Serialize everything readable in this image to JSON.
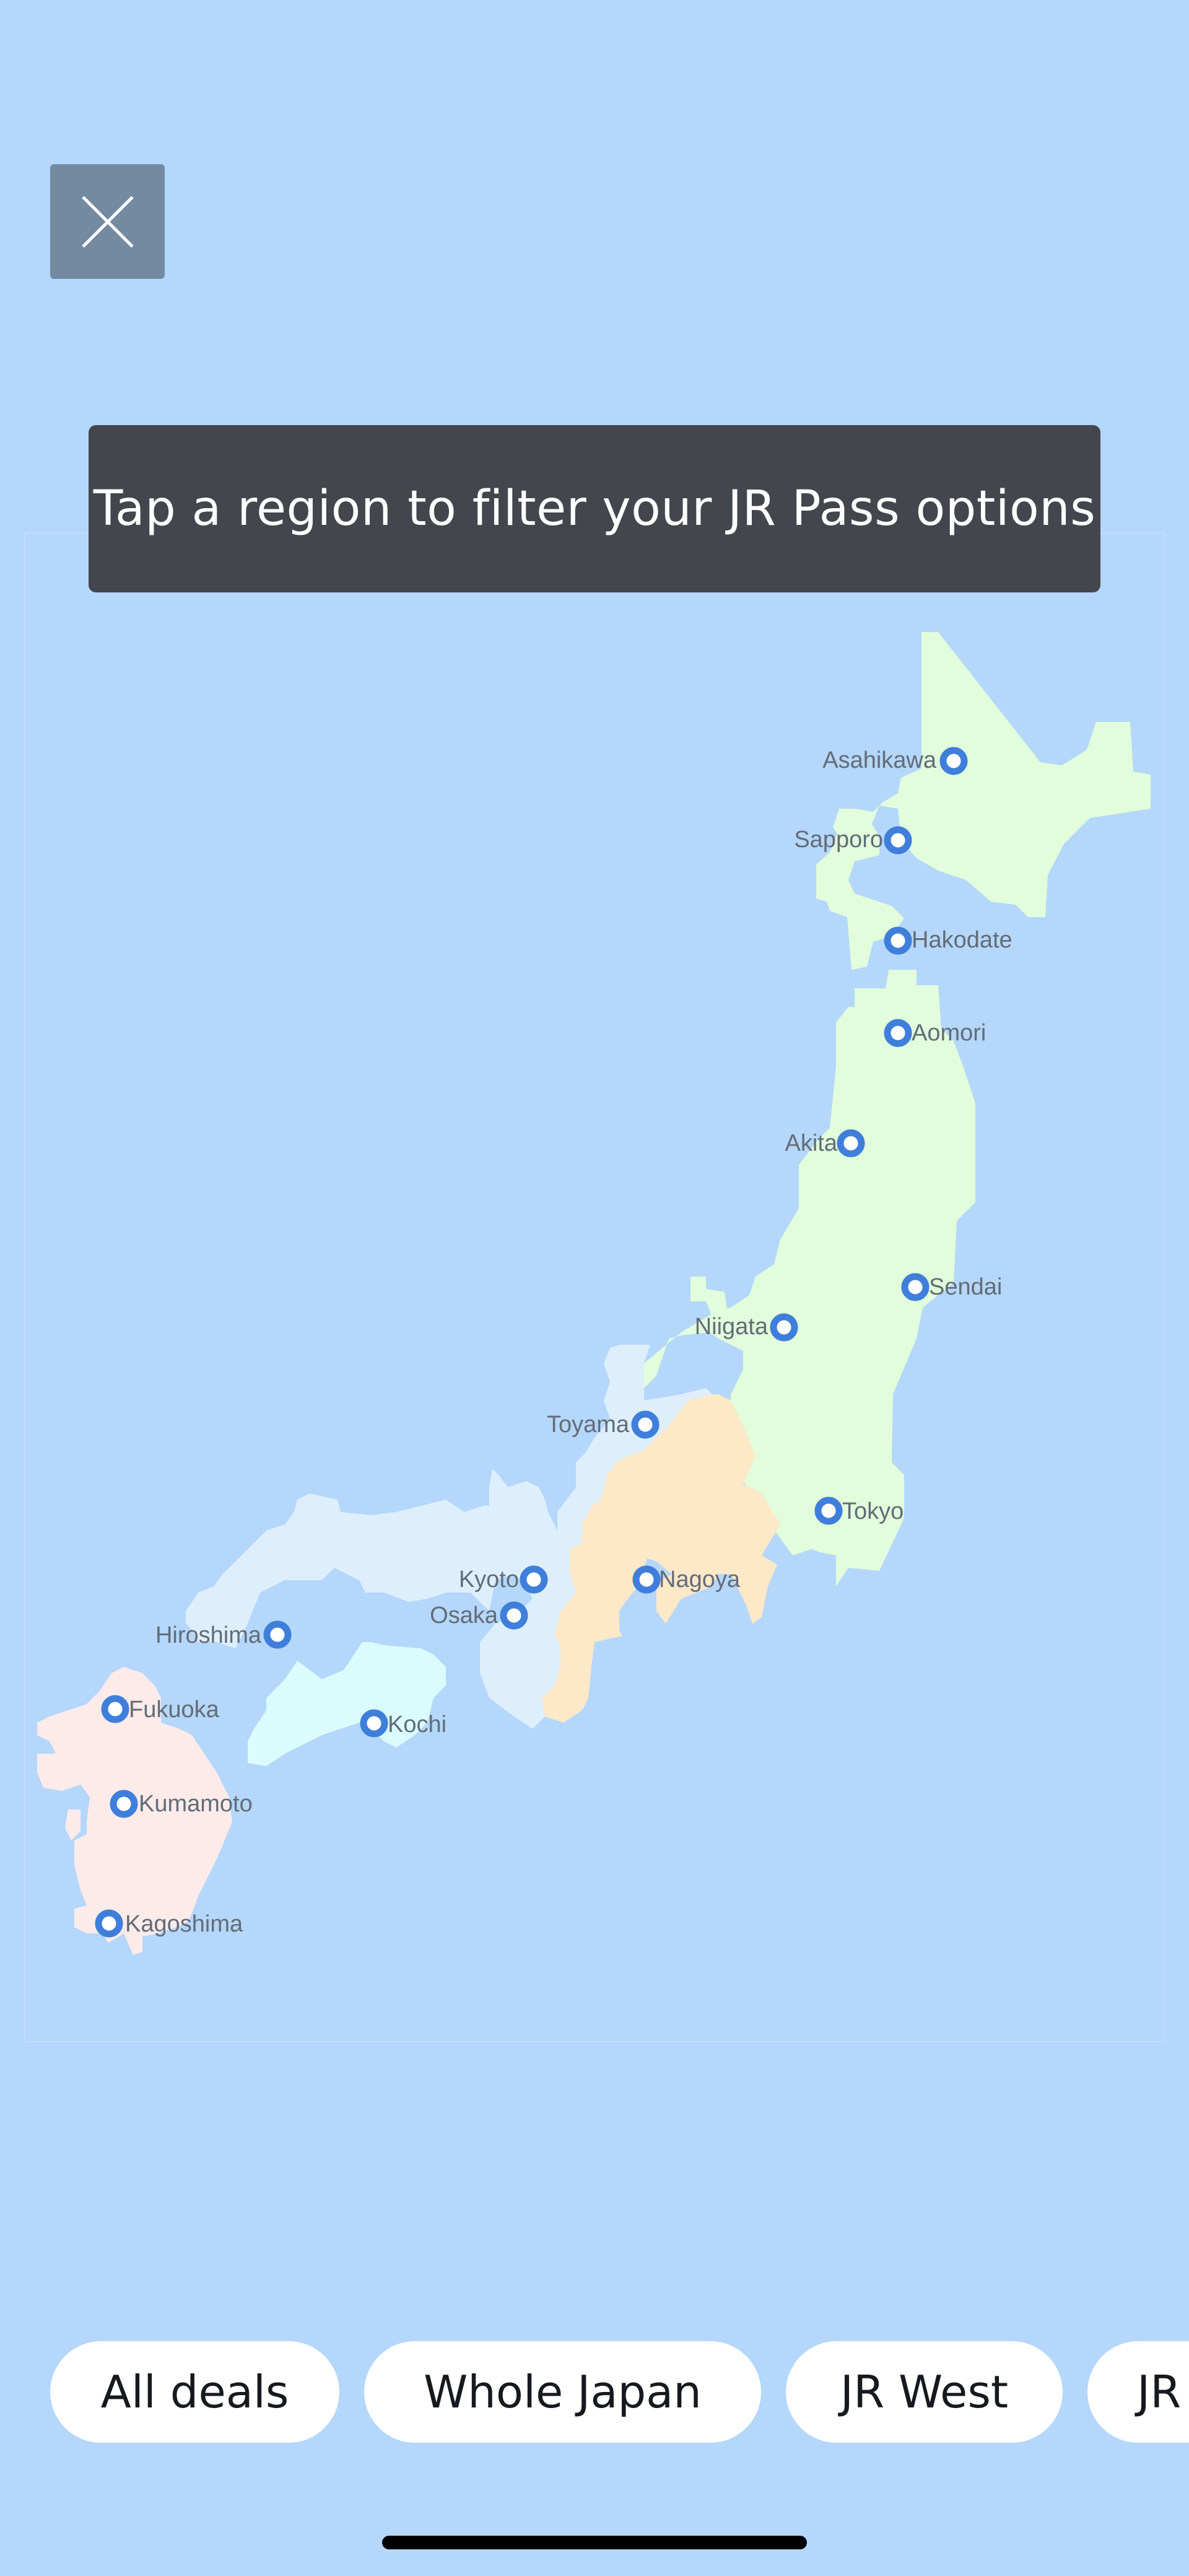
{
  "header": {
    "close_icon": "close-icon"
  },
  "banner": {
    "text": "Tap a region to filter your JR Pass options"
  },
  "map": {
    "colors": {
      "water": "#b4d7fb",
      "hokkaido_tohoku": "#e1fddb",
      "central": "#fde8c8",
      "west": "#ddeffd",
      "shikoku": "#dbfcfd",
      "kyushu": "#fdebea",
      "marker": "#3f7fdb"
    },
    "cities": [
      {
        "name": "Asahikawa"
      },
      {
        "name": "Sapporo"
      },
      {
        "name": "Hakodate"
      },
      {
        "name": "Aomori"
      },
      {
        "name": "Akita"
      },
      {
        "name": "Sendai"
      },
      {
        "name": "Niigata"
      },
      {
        "name": "Toyama"
      },
      {
        "name": "Tokyo"
      },
      {
        "name": "Kyoto"
      },
      {
        "name": "Nagoya"
      },
      {
        "name": "Osaka"
      },
      {
        "name": "Hiroshima"
      },
      {
        "name": "Fukuoka"
      },
      {
        "name": "Kochi"
      },
      {
        "name": "Kumamoto"
      },
      {
        "name": "Kagoshima"
      }
    ]
  },
  "filters": [
    {
      "label": "All deals"
    },
    {
      "label": "Whole Japan"
    },
    {
      "label": "JR West"
    },
    {
      "label": "JR"
    }
  ]
}
